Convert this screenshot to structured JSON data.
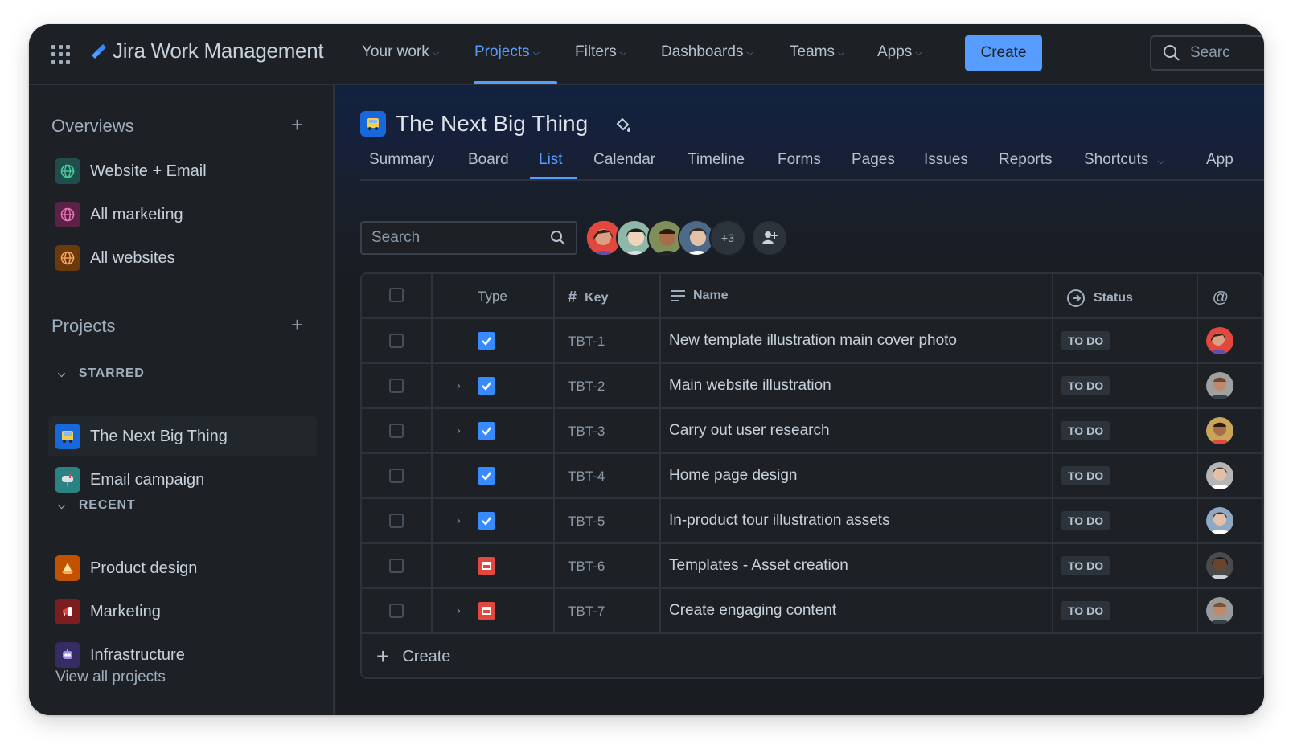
{
  "app": {
    "product_name": "Jira Work Management",
    "accent_color": "#579dff"
  },
  "topnav": {
    "items": [
      {
        "label": "Your work"
      },
      {
        "label": "Projects",
        "active": true
      },
      {
        "label": "Filters"
      },
      {
        "label": "Dashboards"
      },
      {
        "label": "Teams"
      },
      {
        "label": "Apps"
      }
    ],
    "create_label": "Create",
    "search_placeholder": "Searc"
  },
  "sidebar": {
    "overviews_heading": "Overviews",
    "overviews": [
      {
        "label": "Website + Email",
        "icon": "globe-icon",
        "color": "#1f6e6a"
      },
      {
        "label": "All marketing",
        "icon": "globe-icon",
        "color": "#7a2a55"
      },
      {
        "label": "All websites",
        "icon": "globe-icon",
        "color": "#a1560f"
      }
    ],
    "projects_heading": "Projects",
    "starred_label": "STARRED",
    "starred": [
      {
        "label": "The Next Big Thing",
        "icon": "bus-icon",
        "selected": true
      },
      {
        "label": "Email campaign",
        "icon": "mailbox-icon"
      }
    ],
    "recent_label": "RECENT",
    "recent": [
      {
        "label": "Product design",
        "icon": "sailboat-icon"
      },
      {
        "label": "Marketing",
        "icon": "megaphone-icon"
      },
      {
        "label": "Infrastructure",
        "icon": "robot-icon"
      }
    ],
    "view_all_label": "View all projects"
  },
  "project": {
    "title": "The Next Big Thing",
    "tabs": [
      "Summary",
      "Board",
      "List",
      "Calendar",
      "Timeline",
      "Forms",
      "Pages",
      "Issues",
      "Reports",
      "Shortcuts",
      "App"
    ],
    "active_tab": "List",
    "search_placeholder": "Search",
    "extra_members": "+3"
  },
  "table": {
    "headers": {
      "type": "Type",
      "key": "Key",
      "name": "Name",
      "status": "Status"
    },
    "rows": [
      {
        "key": "TBT-1",
        "name": "New template illustration main cover photo",
        "status": "TO DO",
        "type": "task",
        "expandable": false
      },
      {
        "key": "TBT-2",
        "name": "Main website illustration",
        "status": "TO DO",
        "type": "task",
        "expandable": true
      },
      {
        "key": "TBT-3",
        "name": "Carry out user research",
        "status": "TO DO",
        "type": "task",
        "expandable": true
      },
      {
        "key": "TBT-4",
        "name": "Home page design",
        "status": "TO DO",
        "type": "task",
        "expandable": false
      },
      {
        "key": "TBT-5",
        "name": "In-product tour illustration assets",
        "status": "TO DO",
        "type": "task",
        "expandable": true
      },
      {
        "key": "TBT-6",
        "name": "Templates - Asset creation",
        "status": "TO DO",
        "type": "epic",
        "expandable": false
      },
      {
        "key": "TBT-7",
        "name": "Create engaging content",
        "status": "TO DO",
        "type": "epic",
        "expandable": true
      }
    ],
    "create_label": "Create"
  }
}
